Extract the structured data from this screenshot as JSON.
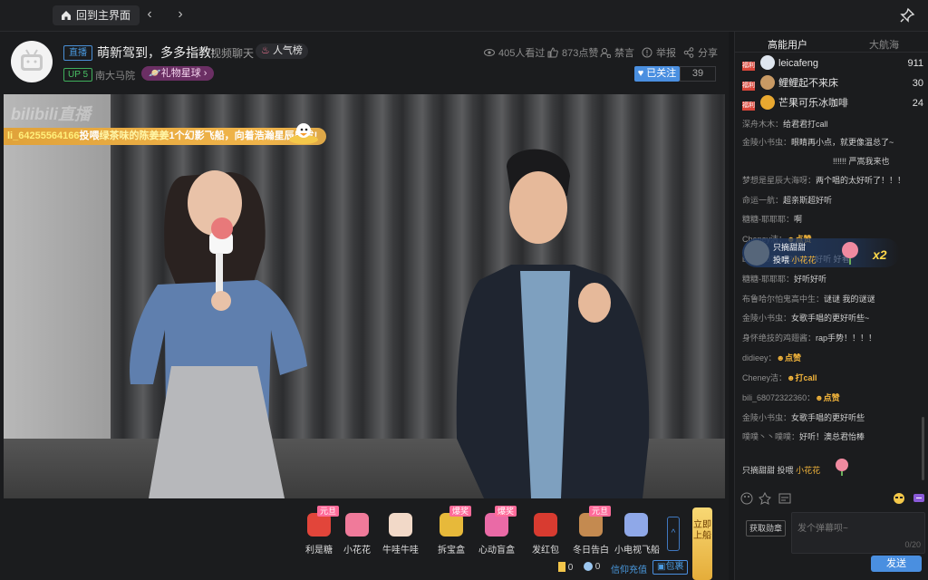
{
  "topbar": {
    "home_label": "回到主界面",
    "back": "‹",
    "forward": "›"
  },
  "header": {
    "live_tag": "直播",
    "title": "萌新驾到，多多指教!",
    "category": "视频聊天",
    "popular": "人气榜",
    "up_level": "UP 5",
    "area": "南大马院",
    "gift_badge": "礼物星球",
    "watchers": "405人看过",
    "likes": "873点赞",
    "ban": "禁言",
    "report": "举报",
    "share": "分享",
    "follow_label": "已关注",
    "follow_count": "39"
  },
  "video": {
    "watermark": "bilibili直播",
    "banner": {
      "user": "li_64255564166",
      "verb": "投喂",
      "target": "绿茶味的陈姜姜",
      "gift": "1个幻影飞船",
      "tail": "，向着浩瀚星辰出发!"
    }
  },
  "gifts": [
    {
      "label": "利是糖",
      "badge": "元旦",
      "color": "#e2453a"
    },
    {
      "label": "小花花",
      "badge": "",
      "color": "#f07a9a"
    },
    {
      "label": "牛哇牛哇",
      "badge": "",
      "color": "#f2d9c8"
    },
    {
      "label": "拆宝盒",
      "badge": "爆奖",
      "color": "#e7b93a"
    },
    {
      "label": "心动盲盒",
      "badge": "爆奖",
      "color": "#ea6aa6"
    },
    {
      "label": "发红包",
      "badge": "",
      "color": "#d83b30"
    },
    {
      "label": "冬日告白",
      "badge": "元旦",
      "color": "#c48a50"
    },
    {
      "label": "小电视飞船",
      "badge": "",
      "color": "#8fa8e8"
    }
  ],
  "gift_more": "^",
  "board_btn": "立即上船",
  "wallet": {
    "gold": "0",
    "silver": "0",
    "recharge": "信仰充值",
    "pack": "包裹"
  },
  "sidebar": {
    "tabs": [
      "高能用户",
      "大航海"
    ],
    "ranks": [
      {
        "badge": "福利",
        "name": "leicafeng",
        "score": "911",
        "avatar_color": "#dfe6ef"
      },
      {
        "badge": "福利",
        "name": "鲤鲤起不来床",
        "score": "30",
        "avatar_color": "#c99a64"
      },
      {
        "badge": "福利",
        "name": "芒果可乐冰咖啡",
        "score": "24",
        "avatar_color": "#e8a830"
      }
    ],
    "float_gift": {
      "user": "只摘甜甜",
      "verb": "投喂",
      "gift": "小花花",
      "combo": "x2"
    },
    "messages": [
      {
        "user": "深舟木木：",
        "text": "给君君打call",
        "type": "text"
      },
      {
        "user": "金陵小书虫：",
        "text": "眼睛再小点，就更像温总了~",
        "type": "text"
      },
      {
        "user": "",
        "text": "!!!!!! 严嵩我来也",
        "type": "text"
      },
      {
        "user": "梦想是星辰大海呀：",
        "text": "两个唱的太好听了！！！",
        "type": "text"
      },
      {
        "user": "命运一航：",
        "text": "超亲斯超好听",
        "type": "text"
      },
      {
        "user": "糖糖-耶耶耶：",
        "text": "啊",
        "type": "text"
      },
      {
        "user": "Cheney洁：",
        "text": "点赞",
        "type": "emote"
      },
      {
        "user": "bili_68072322360：",
        "text": "好听 好看",
        "type": "text"
      },
      {
        "user": "糖糖-耶耶耶：",
        "text": "好听好听",
        "type": "text"
      },
      {
        "user": "布鲁哈尔怕鬼高中生：",
        "text": "谜谜 我的谜谜",
        "type": "text"
      },
      {
        "user": "金陵小书虫：",
        "text": "女歌手唱的更好听些~",
        "type": "text"
      },
      {
        "user": "身怀绝技的鸡翅酱：",
        "text": "rap手势！！！！",
        "type": "text"
      },
      {
        "user": "didieey：",
        "text": "点赞",
        "type": "emote"
      },
      {
        "user": "Cheney洁：",
        "text": "打call",
        "type": "emote"
      },
      {
        "user": "bili_68072322360：",
        "text": "点赞",
        "type": "emote"
      },
      {
        "user": "金陵小书虫：",
        "text": "女歌手唱的更好听些",
        "type": "text"
      },
      {
        "user": "噗噗丶丶噗噗：",
        "text": "好听！澳总君怡棒",
        "type": "text"
      }
    ],
    "last_gift": {
      "user": "只摘甜甜",
      "verb": "投喂",
      "gift": "小花花"
    },
    "medal_btn": "获取勋章",
    "input_placeholder": "发个弹幕呗~",
    "counter": "0/20",
    "send_label": "发送"
  }
}
